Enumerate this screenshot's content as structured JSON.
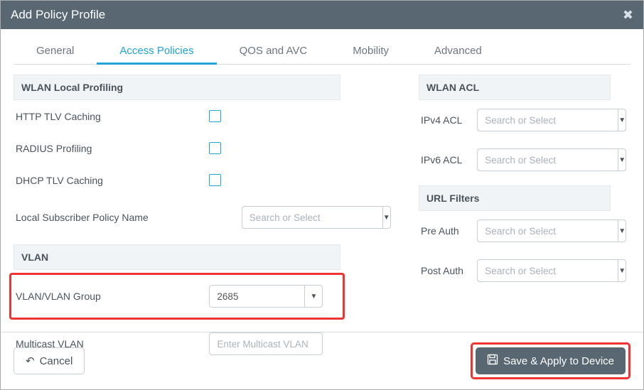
{
  "dialog": {
    "title": "Add Policy Profile"
  },
  "tabs": {
    "general": "General",
    "access_policies": "Access Policies",
    "qos_avc": "QOS and AVC",
    "mobility": "Mobility",
    "advanced": "Advanced",
    "active": "access_policies"
  },
  "left": {
    "section_wlan_local": "WLAN Local Profiling",
    "http_tlv_caching": "HTTP TLV Caching",
    "radius_profiling": "RADIUS Profiling",
    "dhcp_tlv_caching": "DHCP TLV Caching",
    "local_subscriber_policy_name": "Local Subscriber Policy Name",
    "local_subscriber_placeholder": "Search or Select",
    "section_vlan": "VLAN",
    "vlan_group": "VLAN/VLAN Group",
    "vlan_group_value": "2685",
    "multicast_vlan": "Multicast VLAN",
    "multicast_placeholder": "Enter Multicast VLAN"
  },
  "right": {
    "section_wlan_acl": "WLAN ACL",
    "ipv4_acl": "IPv4 ACL",
    "ipv6_acl": "IPv6 ACL",
    "section_url_filters": "URL Filters",
    "pre_auth": "Pre Auth",
    "post_auth": "Post Auth",
    "select_placeholder": "Search or Select"
  },
  "footer": {
    "cancel": "Cancel",
    "save": "Save & Apply to Device"
  }
}
